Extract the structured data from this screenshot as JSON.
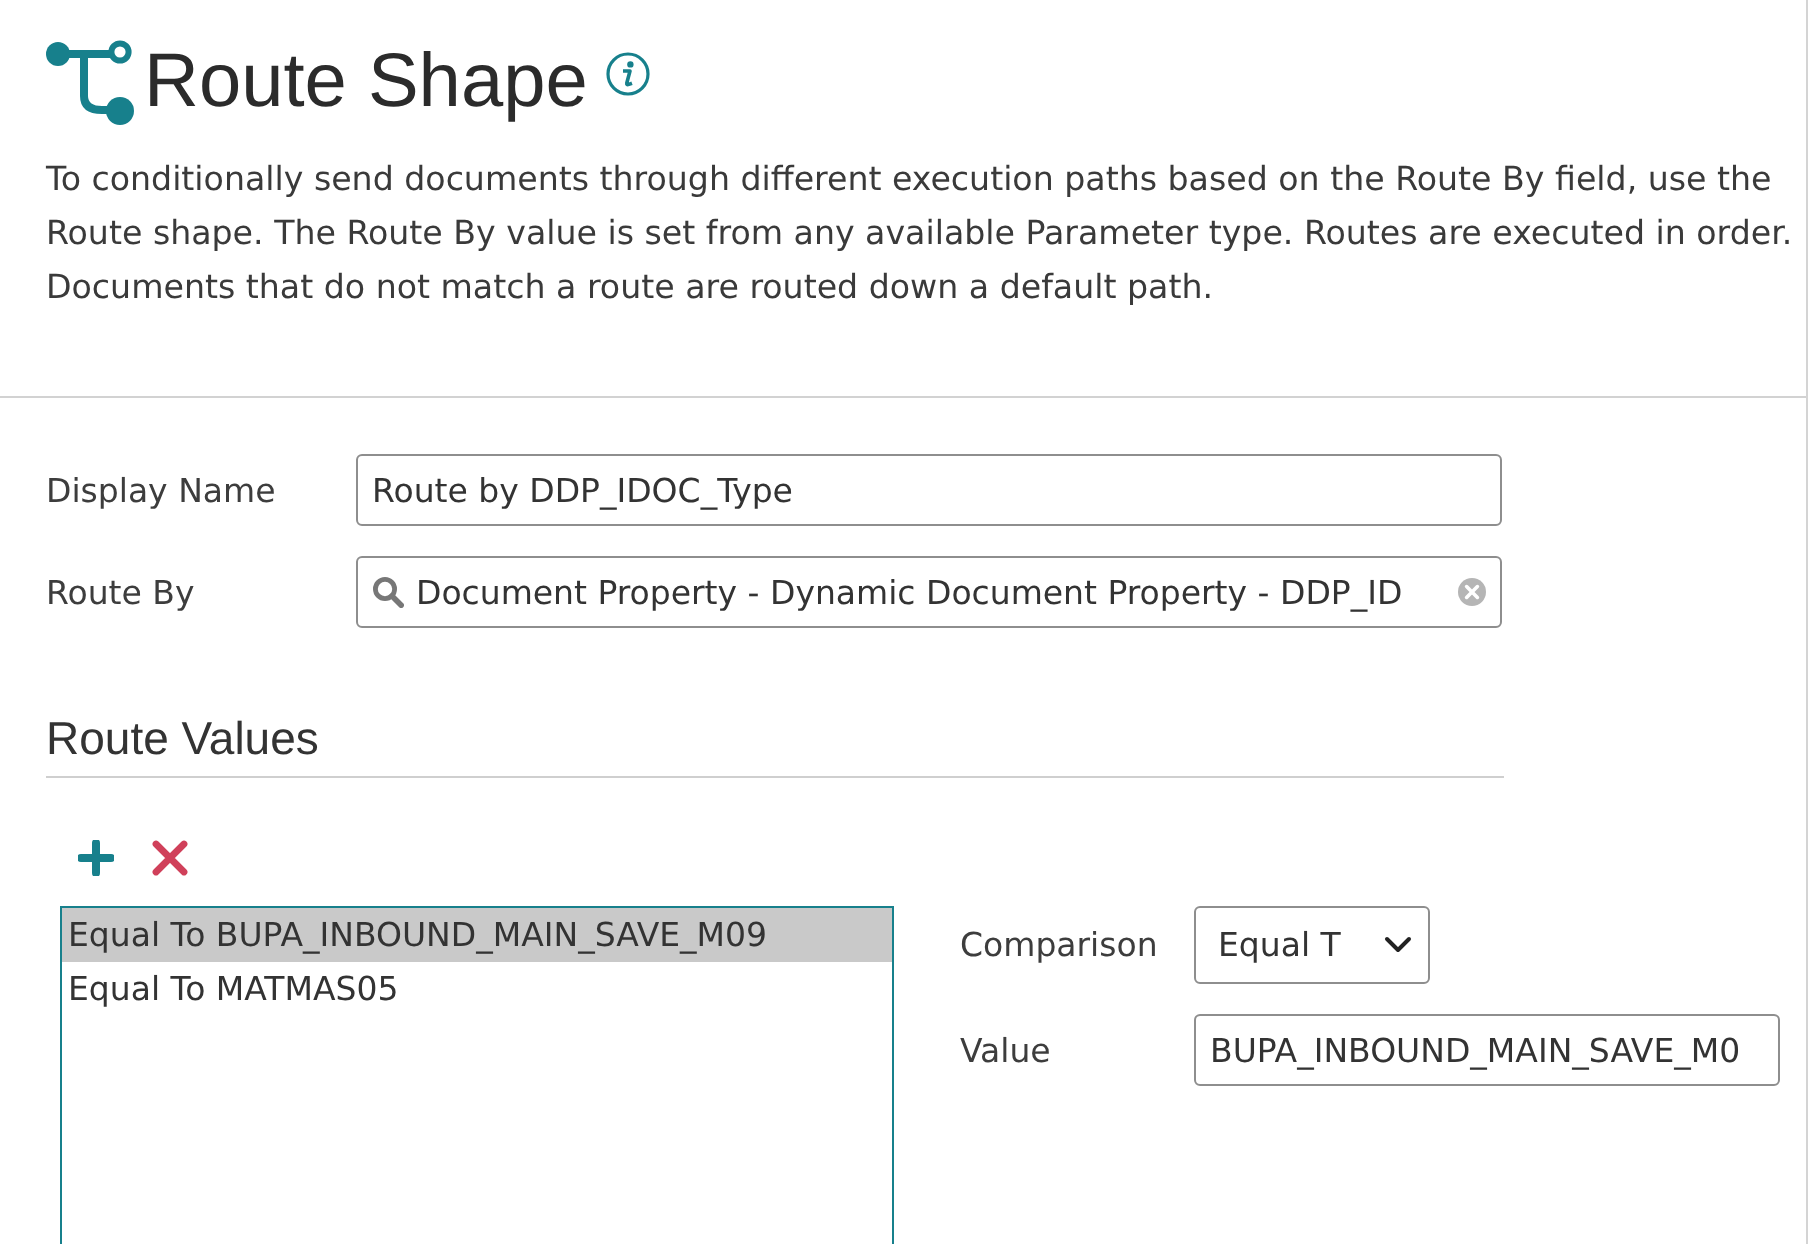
{
  "header": {
    "title": "Route Shape"
  },
  "description": "To conditionally send documents through different execution paths based on the Route By field, use the\nRoute shape. The Route By value is set from any available Parameter type. Routes are executed in order.\nDocuments that do not match a route are routed down a default path.",
  "fields": [
    {
      "label": "Display Name",
      "value": "Route by DDP_IDOC_Type",
      "kind": "text"
    },
    {
      "label": "Route By",
      "value": "Document Property - Dynamic Document Property - DDP_ID",
      "kind": "search"
    }
  ],
  "route_values": {
    "title": "Route Values",
    "items": [
      {
        "label": "Equal To BUPA_INBOUND_MAIN_SAVE_M09",
        "selected": true
      },
      {
        "label": "Equal To MATMAS05",
        "selected": false
      }
    ]
  },
  "detail": [
    {
      "label": "Comparison",
      "value": "Equal T",
      "kind": "select"
    },
    {
      "label": "Value",
      "value": "BUPA_INBOUND_MAIN_SAVE_M0",
      "kind": "text"
    }
  ]
}
